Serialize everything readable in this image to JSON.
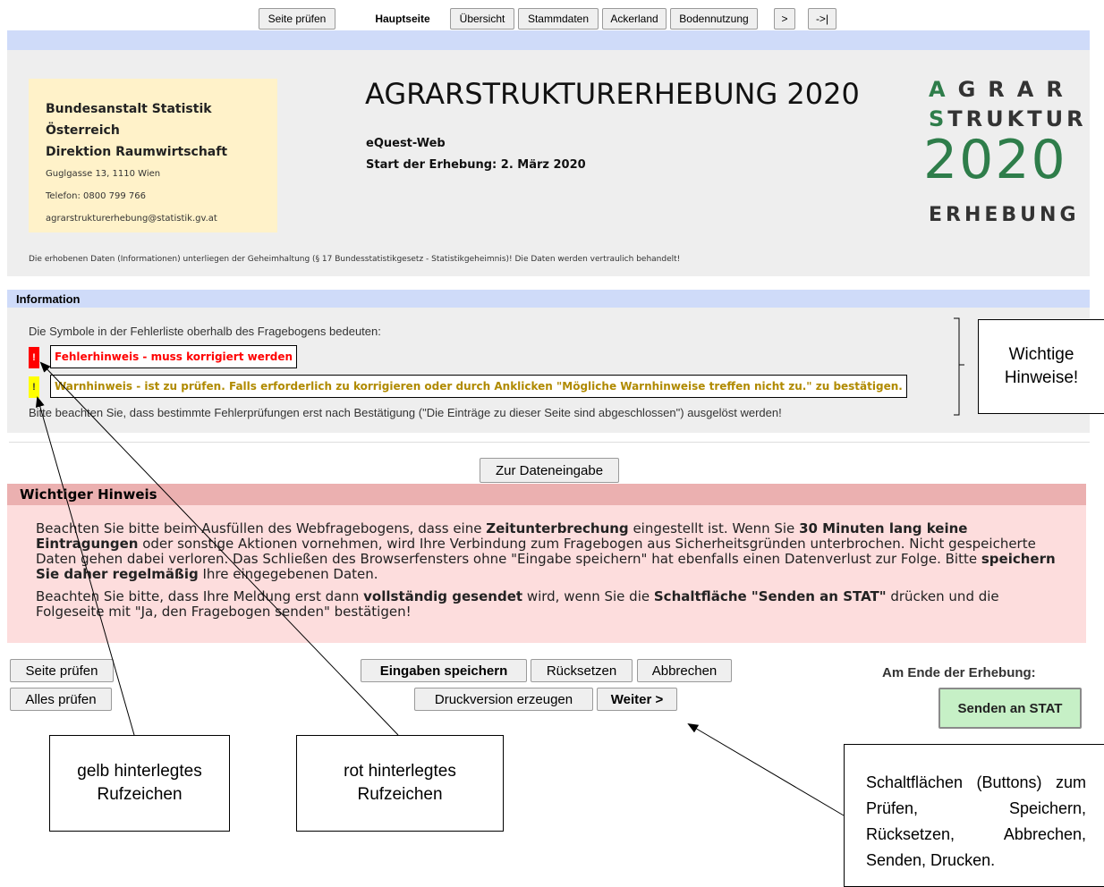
{
  "tabs": {
    "seite_pruefen": "Seite prüfen",
    "hauptseite": "Hauptseite",
    "uebersicht": "Übersicht",
    "stammdaten": "Stammdaten",
    "ackerland": "Ackerland",
    "bodennutzung": "Bodennutzung",
    "next": ">",
    "last": "->|"
  },
  "header": {
    "org_name": "Bundesanstalt Statistik Österreich",
    "org_dept": "Direktion Raumwirtschaft",
    "address": "Guglgasse 13, 1110 Wien",
    "phone": "Telefon: 0800 799 766",
    "email": "agrarstrukturerhebung@statistik.gv.at",
    "title": "AGRARSTRUKTURERHEBUNG 2020",
    "subtitle1": "eQuest-Web",
    "subtitle2": "Start der Erhebung: 2. März 2020",
    "logo_line1": "AGRAR",
    "logo_line2": "STRUKTUR",
    "logo_year": "2020",
    "logo_line4": "ERHEBUNG",
    "confidentiality": "Die erhobenen Daten (Informationen) unterliegen der Geheimhaltung (§ 17 Bundesstatistikgesetz - Statistikgeheimnis)! Die Daten werden vertraulich behandelt!"
  },
  "info": {
    "heading": "Information",
    "intro": "Die Symbole in der Fehlerliste oberhalb des Fragebogens bedeuten:",
    "error_symbol": "!",
    "error_text": "Fehlerhinweis - muss korrigiert werden",
    "warn_symbol": "!",
    "warn_text": "Warnhinweis - ist zu prüfen. Falls erforderlich zu korrigieren oder durch Anklicken \"Mögliche Warnhinweise treffen nicht zu.\" zu bestätigen.",
    "note": "Bitte beachten Sie, dass bestimmte Fehlerprüfungen erst nach Bestätigung (\"Die Einträge zu dieser Seite sind abgeschlossen\") ausgelöst werden!"
  },
  "zur_dateneingabe": "Zur Dateneingabe",
  "warning": {
    "heading": "Wichtiger Hinweis",
    "p1_a": "Beachten Sie bitte beim Ausfüllen des Webfragebogens, dass eine ",
    "p1_b": "Zeitunterbrechung",
    "p1_c": " eingestellt ist. Wenn Sie ",
    "p1_d": "30 Minuten lang keine Eintragungen",
    "p1_e": " oder sonstige Aktionen vornehmen, wird Ihre Verbindung zum Fragebogen aus Sicherheitsgründen unterbrochen. Nicht gespeicherte Daten gehen dabei verloren. Das Schließen des Browserfensters ohne \"Eingabe speichern\" hat ebenfalls einen Datenverlust zur Folge. Bitte ",
    "p1_f": "speichern Sie daher regelmäßig",
    "p1_g": " Ihre eingegebenen Daten.",
    "p2_a": "Beachten Sie bitte, dass Ihre Meldung erst dann ",
    "p2_b": "vollständig gesendet",
    "p2_c": " wird, wenn Sie die ",
    "p2_d": "Schaltfläche \"Senden an STAT\"",
    "p2_e": " drücken und die Folgeseite mit \"Ja, den Fragebogen senden\" bestätigen!"
  },
  "buttons": {
    "seite_pruefen": "Seite prüfen",
    "alles_pruefen": "Alles prüfen",
    "eingaben_speichern": "Eingaben speichern",
    "ruecksetzen": "Rücksetzen",
    "abbrechen": "Abbrechen",
    "druckversion": "Druckversion erzeugen",
    "weiter": "Weiter >",
    "am_ende": "Am Ende der Erhebung:",
    "senden": "Senden an STAT"
  },
  "callouts": {
    "wichtige": "Wichtige Hinweise!",
    "gelb": "gelb hinterlegtes Rufzeichen",
    "rot": "rot hinterlegtes Rufzeichen",
    "schalt": "Schaltflächen (Buttons) zum Prüfen, Speichern, Rücksetzen, Abbrechen, Senden, Drucken."
  },
  "colors": {
    "accent_blue": "#cfdbf9",
    "header_grey": "#eeeeee",
    "info_grey": "#eeeeee",
    "address_yellow": "#fff2c9",
    "error_red": "#ff0000",
    "warn_yellow": "#ffff00",
    "warn_text": "#b08a00",
    "warning_head": "#ebb0b0",
    "warning_body": "#fddddd",
    "logo_green": "#2e7d4a",
    "senden_green": "#c6f0c6"
  }
}
